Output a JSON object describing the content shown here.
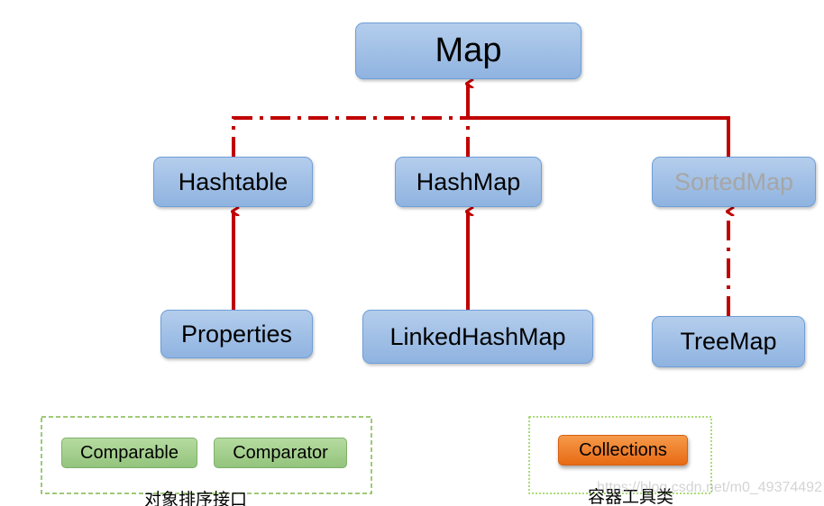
{
  "nodes": {
    "map": "Map",
    "hashtable": "Hashtable",
    "hashmap": "HashMap",
    "sortedmap": "SortedMap",
    "properties": "Properties",
    "linkedhashmap": "LinkedHashMap",
    "treemap": "TreeMap"
  },
  "groups": {
    "sorting": {
      "items": [
        "Comparable",
        "Comparator"
      ],
      "caption": "对象排序接口"
    },
    "utility": {
      "items": [
        "Collections"
      ],
      "caption": "容器工具类"
    }
  },
  "watermark": "https://blog.csdn.net/m0_49374492",
  "colors": {
    "arrow": "#c00000",
    "node": "#9dbde6",
    "sortedmap_text": "#a6a6a6",
    "collections": "#ef7a22",
    "green": "#a5cf8e"
  }
}
